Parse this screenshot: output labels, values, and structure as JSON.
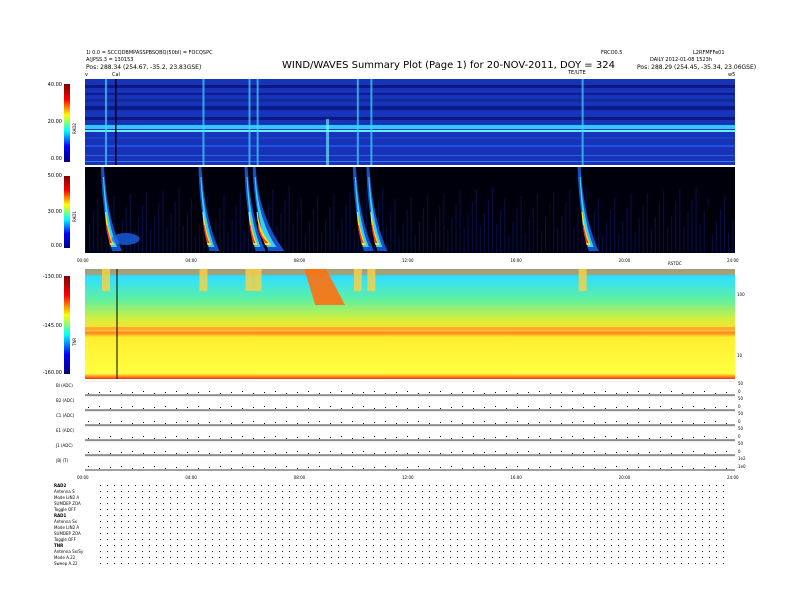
{
  "header": {
    "left_line1": "1l 0.0 = SCCQDBMPASSPBSQBQ(50bl) = FOCQSPC",
    "left_line2": "A(JPSS.3 = 130153",
    "left_line3": "Pos:  288.34 (254.67, -35.2, 23.83GSE)",
    "title": "WIND/WAVES Summary Plot (Page 1) for 20-NOV-2011, DOY = 324",
    "right_top_left": "FRCO0.5",
    "right_top_right": "L2RFMFFe01",
    "right_line2": "DAILY 2012-01-08 1523h",
    "right_line3": "Pos:  288.29 (254.45, -35.34, 23.06GSE)",
    "marker_left": "v",
    "marker_cal": "Cal",
    "marker_te": "TE/UTE",
    "marker_right": "w5"
  },
  "colors": {
    "rad2_bg": "#1a2fb0",
    "rad1_bg": "#000010",
    "tnr_bg": "#ffff30",
    "tnr_top": "#00e0ff",
    "accent_red": "#ff2000"
  },
  "chart_data": [
    {
      "type": "heatmap",
      "panel": "RAD2",
      "ylabel": "RAD2",
      "yticks": [
        "40.00",
        "20.00",
        "0.00"
      ],
      "ylim": [
        0,
        40
      ],
      "colorbar": "jet"
    },
    {
      "type": "heatmap",
      "panel": "RAD1",
      "ylabel": "RAD1",
      "yticks": [
        "50.00",
        "30.00",
        "0.00"
      ],
      "ylim": [
        0,
        50
      ],
      "xticks": [
        "00:00",
        "04:00",
        "08:00",
        "12:00",
        "16:00",
        "20:00",
        "24:00"
      ],
      "xlim": [
        0,
        24
      ],
      "extra_label": "RSTDC",
      "bursts_hours": [
        0.7,
        4.3,
        6.0,
        6.3,
        10.0,
        10.5,
        18.3
      ]
    },
    {
      "type": "heatmap",
      "panel": "TNR",
      "ylabel": "TNR",
      "yticks": [
        "-130.00",
        "-145.00",
        "-160.00"
      ],
      "ylim": [
        -160,
        -130
      ],
      "right_ticks": [
        "100",
        "10"
      ],
      "colorbar": "jet"
    },
    {
      "type": "line",
      "panel": "housekeeping",
      "rows": [
        "Bl (ADC)",
        "B2 (ADC)",
        "C1 (ADC)",
        "E1 (ADC)",
        "J1 (ADC)",
        "|B| (T)"
      ],
      "right_ticks": [
        [
          "50",
          "0"
        ],
        [
          "50",
          "0"
        ],
        [
          "50",
          "0"
        ],
        [
          "50",
          "0"
        ],
        [
          "50",
          "0"
        ],
        [
          "1e2",
          "1e0"
        ]
      ],
      "xticks": [
        "00:00",
        "04:00",
        "08:00",
        "12:00",
        "16:00",
        "20:00",
        "24:00"
      ],
      "xlim": [
        0,
        24
      ]
    }
  ],
  "status": {
    "rad2_header": "RAD2",
    "rad2_rows": [
      [
        "Antenna",
        "S"
      ],
      [
        "Mode",
        "LIN2 A"
      ],
      [
        "SUMDEP",
        "ZOA"
      ],
      [
        "Toggle",
        "OFF"
      ]
    ],
    "rad1_header": "RAD1",
    "rad1_rows": [
      [
        "Antenna",
        "Sx"
      ],
      [
        "Mode",
        "LIN2 A"
      ],
      [
        "SUMDEP",
        "ZOA"
      ],
      [
        "Toggle",
        "OFF"
      ]
    ],
    "tnr_header": "TNR",
    "tnr_rows": [
      [
        "Antenna",
        "Sx/Sy"
      ],
      [
        "Mode",
        "A.22"
      ],
      [
        "Sweep",
        "A.22"
      ]
    ]
  }
}
